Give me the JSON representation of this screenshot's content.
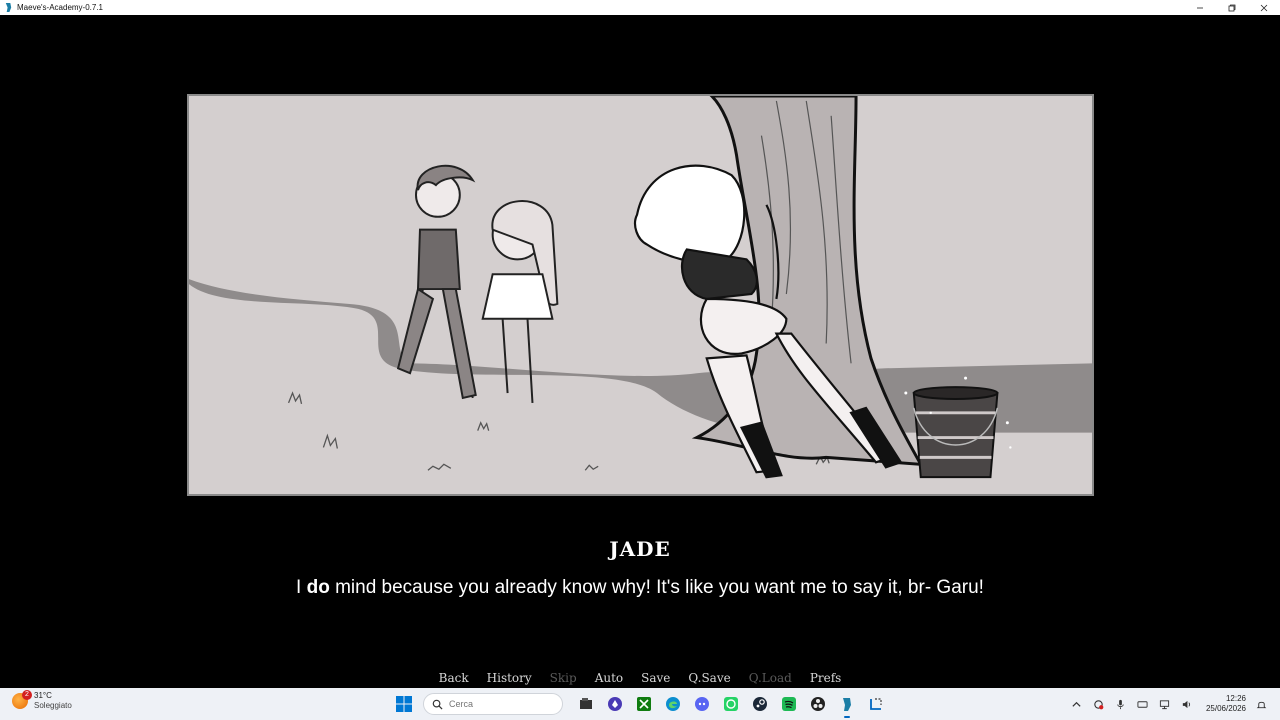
{
  "window": {
    "title": "Maeve's-Academy-0.7.1"
  },
  "dialogue": {
    "speaker": "JADE",
    "text_before": "I ",
    "text_bold": "do",
    "text_after": " mind because you already know why! It's like you want me to say it, br- Garu!"
  },
  "quick_menu": {
    "back": "Back",
    "history": "History",
    "skip": "Skip",
    "auto": "Auto",
    "save": "Save",
    "qsave": "Q.Save",
    "qload": "Q.Load",
    "prefs": "Prefs"
  },
  "taskbar": {
    "weather_temp": "31°C",
    "weather_cond": "Soleggiato",
    "weather_badge": "2",
    "search_placeholder": "Cerca",
    "time": "12:26",
    "date": "25/06/2026"
  },
  "colors": {
    "scene_bg": "#d4cfcf",
    "path": "#8f8b8b",
    "taskbar_bg": "#eef1f6",
    "accent": "#0067c0"
  }
}
